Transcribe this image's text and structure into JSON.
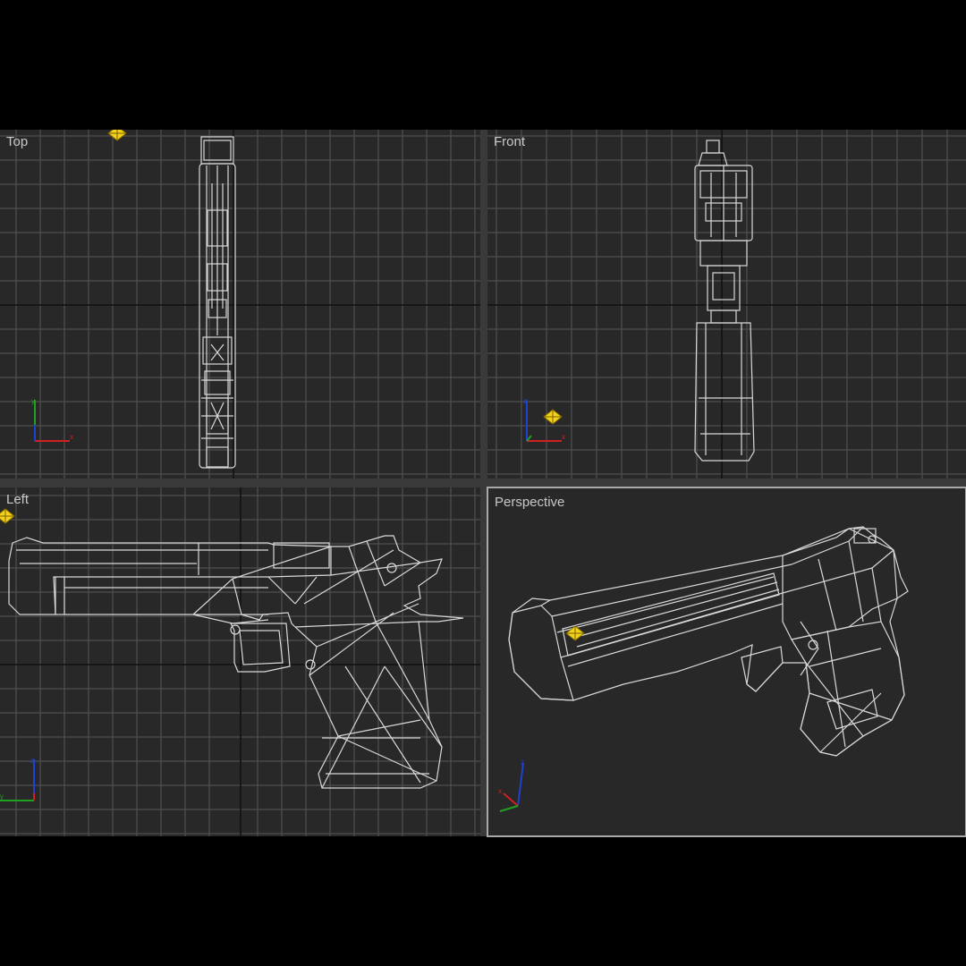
{
  "viewports": {
    "top": {
      "label": "Top"
    },
    "front": {
      "label": "Front"
    },
    "left": {
      "label": "Left"
    },
    "perspective": {
      "label": "Perspective"
    }
  },
  "colors": {
    "background": "#000000",
    "viewport_bg": "#282828",
    "grid_line": "#4e4e4e",
    "grid_major": "#111111",
    "wireframe": "#d8d8d8",
    "active_border": "#a8a8a8",
    "light_helper": "#f2d21c",
    "axis_x": "#d02020",
    "axis_y": "#20a020",
    "axis_z": "#2040d0"
  },
  "icons": {
    "light": "light-helper-icon",
    "axis": "axis-tripod-icon"
  }
}
